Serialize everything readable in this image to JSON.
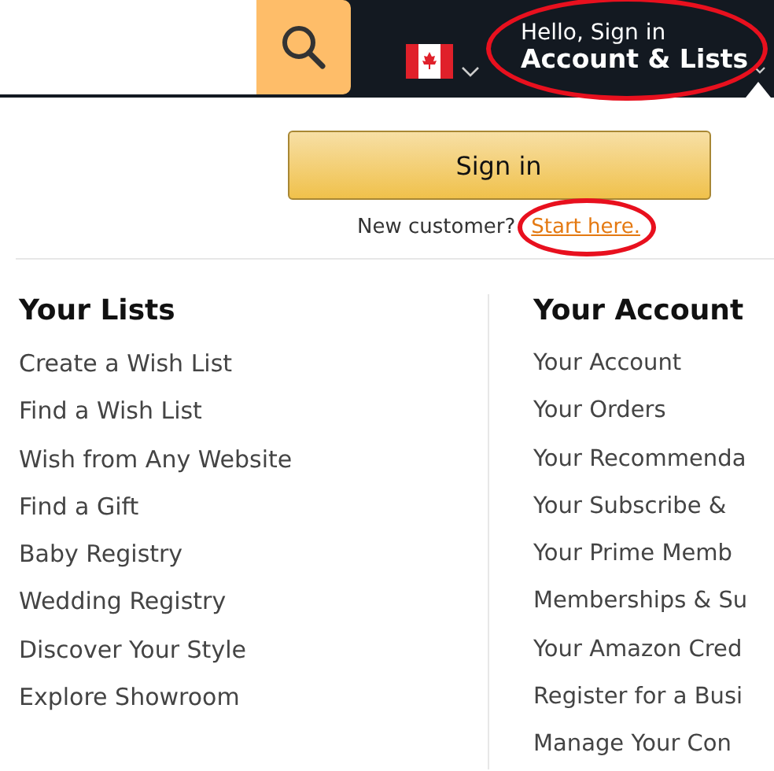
{
  "header": {
    "greeting": "Hello, Sign in",
    "account_label": "Account & Lists",
    "circled": true
  },
  "sign_in": {
    "button": "Sign in",
    "new_customer": "New customer?",
    "start_link": "Start here.",
    "link_circled": true
  },
  "columns": [
    {
      "heading": "Your Lists",
      "items": [
        "Create a Wish List",
        "Find a Wish List",
        "Wish from Any Website",
        "Find a Gift",
        "Baby Registry",
        "Wedding Registry",
        "Discover Your Style",
        "Explore Showroom"
      ]
    },
    {
      "heading": "Your Account",
      "items": [
        "Your Account",
        "Your Orders",
        "Your Recommenda",
        "Your Subscribe &",
        "Your Prime Memb",
        "Memberships & Su",
        "Your Amazon Cred",
        "Register for a Busi",
        "Manage Your Con"
      ]
    }
  ]
}
